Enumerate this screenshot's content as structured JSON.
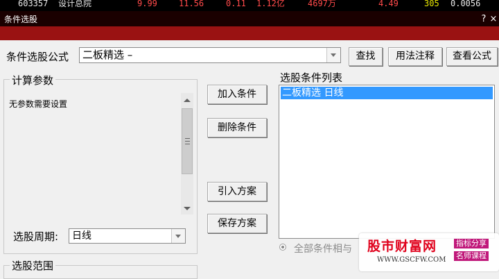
{
  "ticker": {
    "code": "603357",
    "name": "设计总院",
    "values": [
      "9.99",
      "11.56",
      "0.11",
      "1.12亿",
      "4697万",
      "4.49",
      "305",
      "0.0056"
    ]
  },
  "window": {
    "title": "条件选股",
    "help_icon": "?",
    "close_icon": "×"
  },
  "formula": {
    "label": "条件选股公式",
    "value": "二板精选   –",
    "find_btn": "查找",
    "usage_btn": "用法注释",
    "view_btn": "查看公式"
  },
  "params": {
    "title": "计算参数",
    "empty_text": "无参数需要设置"
  },
  "period": {
    "label": "选股周期:",
    "value": "日线"
  },
  "range": {
    "title": "选股范围"
  },
  "actions": {
    "add": "加入条件",
    "delete": "删除条件",
    "import": "引入方案",
    "save": "保存方案"
  },
  "conditions": {
    "title": "选股条件列表",
    "items": [
      "二板精选   日线"
    ]
  },
  "logic": {
    "all_and": "全部条件相与"
  },
  "watermark": {
    "brand": "股市财富网",
    "tag1": "指标分享",
    "tag2": "名师课程",
    "url": "WWW.GSCFW.COM"
  },
  "colors": {
    "titlebar": "#1a0000",
    "red_band": "#9a1212",
    "selection": "#3399ff",
    "brand": "#e0001b"
  }
}
